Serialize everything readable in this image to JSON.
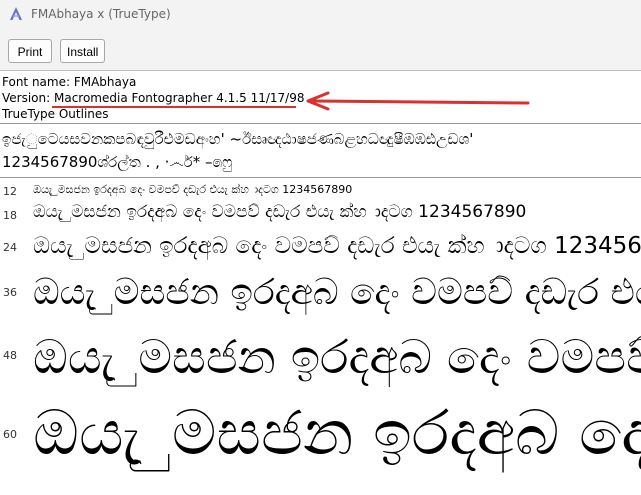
{
  "window": {
    "title": "FMAbhaya x (TrueType)",
    "icon": "font-viewer-icon"
  },
  "toolbar": {
    "print_label": "Print",
    "install_label": "Install"
  },
  "info": {
    "font_name": "Font name: FMAbhaya",
    "version_prefix": "Version: ",
    "version_value": "Macromedia Fontographer 4.1.5 11/17/98",
    "outlines": "TrueType Outlines"
  },
  "annotation": {
    "arrow_color": "#d93030",
    "underline_color": "#d93030"
  },
  "charset": {
    "line1": "ඉජැුටෙයසවනකපබඳවුරීඑමඩඅංහ' ~ඊසෘඥඨාෂජණබළහධඥුෂීඹඹඪඋඩශ'",
    "line2": "1234567890ශ්රල්ත . , ·෴ර්* –෧ෆු"
  },
  "samples": {
    "text": "ඔයැ ුමසජන ඉරදඅබ දෙං වමපව් දඩැර එයැ ක්හ ාදටග 1234567890",
    "rows": [
      {
        "size": "12"
      },
      {
        "size": "18"
      },
      {
        "size": "24"
      },
      {
        "size": "36"
      },
      {
        "size": "48"
      },
      {
        "size": "60"
      }
    ]
  }
}
